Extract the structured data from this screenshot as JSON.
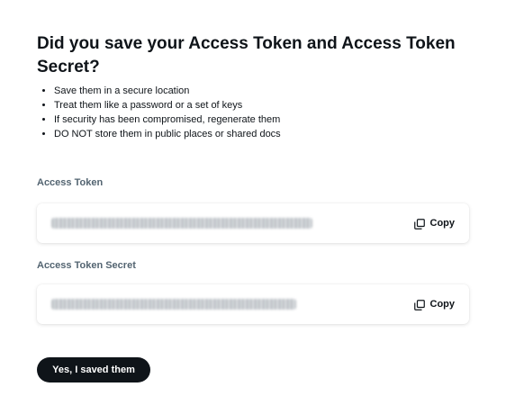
{
  "header": {
    "title": "Did you save your Access Token and Access Token Secret?"
  },
  "bullets": [
    "Save them in a secure location",
    "Treat them like a password or a set of keys",
    "If security has been compromised, regenerate them",
    "DO NOT store them in public places or shared docs"
  ],
  "access_token": {
    "label": "Access Token",
    "value_state": "blurred",
    "copy_label": "Copy",
    "copy_icon": "copy-icon"
  },
  "access_token_secret": {
    "label": "Access Token Secret",
    "value_state": "blurred",
    "copy_label": "Copy",
    "copy_icon": "copy-icon"
  },
  "actions": {
    "confirm_label": "Yes, I saved them"
  },
  "colors": {
    "text_primary": "#0f1419",
    "text_secondary": "#536471",
    "button_bg": "#0f1419",
    "button_text": "#ffffff"
  }
}
